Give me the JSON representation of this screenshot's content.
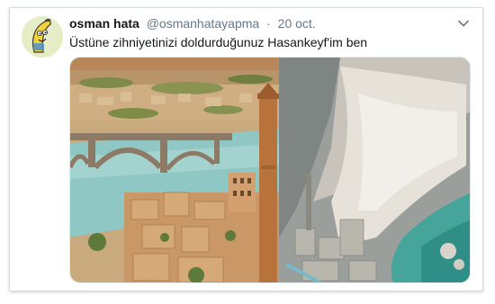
{
  "tweet": {
    "author_name": "osman hata",
    "author_handle": "@osmanhatayapma",
    "separator": "·",
    "date": "20 oct.",
    "text": "Üstüne zihniyetinizi doldurduğunuz Hasankeyf'im ben",
    "avatar_icon": "banana-character-avatar",
    "menu_icon": "chevron-down-icon"
  },
  "colors": {
    "name": "#14171a",
    "secondary": "#657786",
    "border": "#d8dde1"
  }
}
